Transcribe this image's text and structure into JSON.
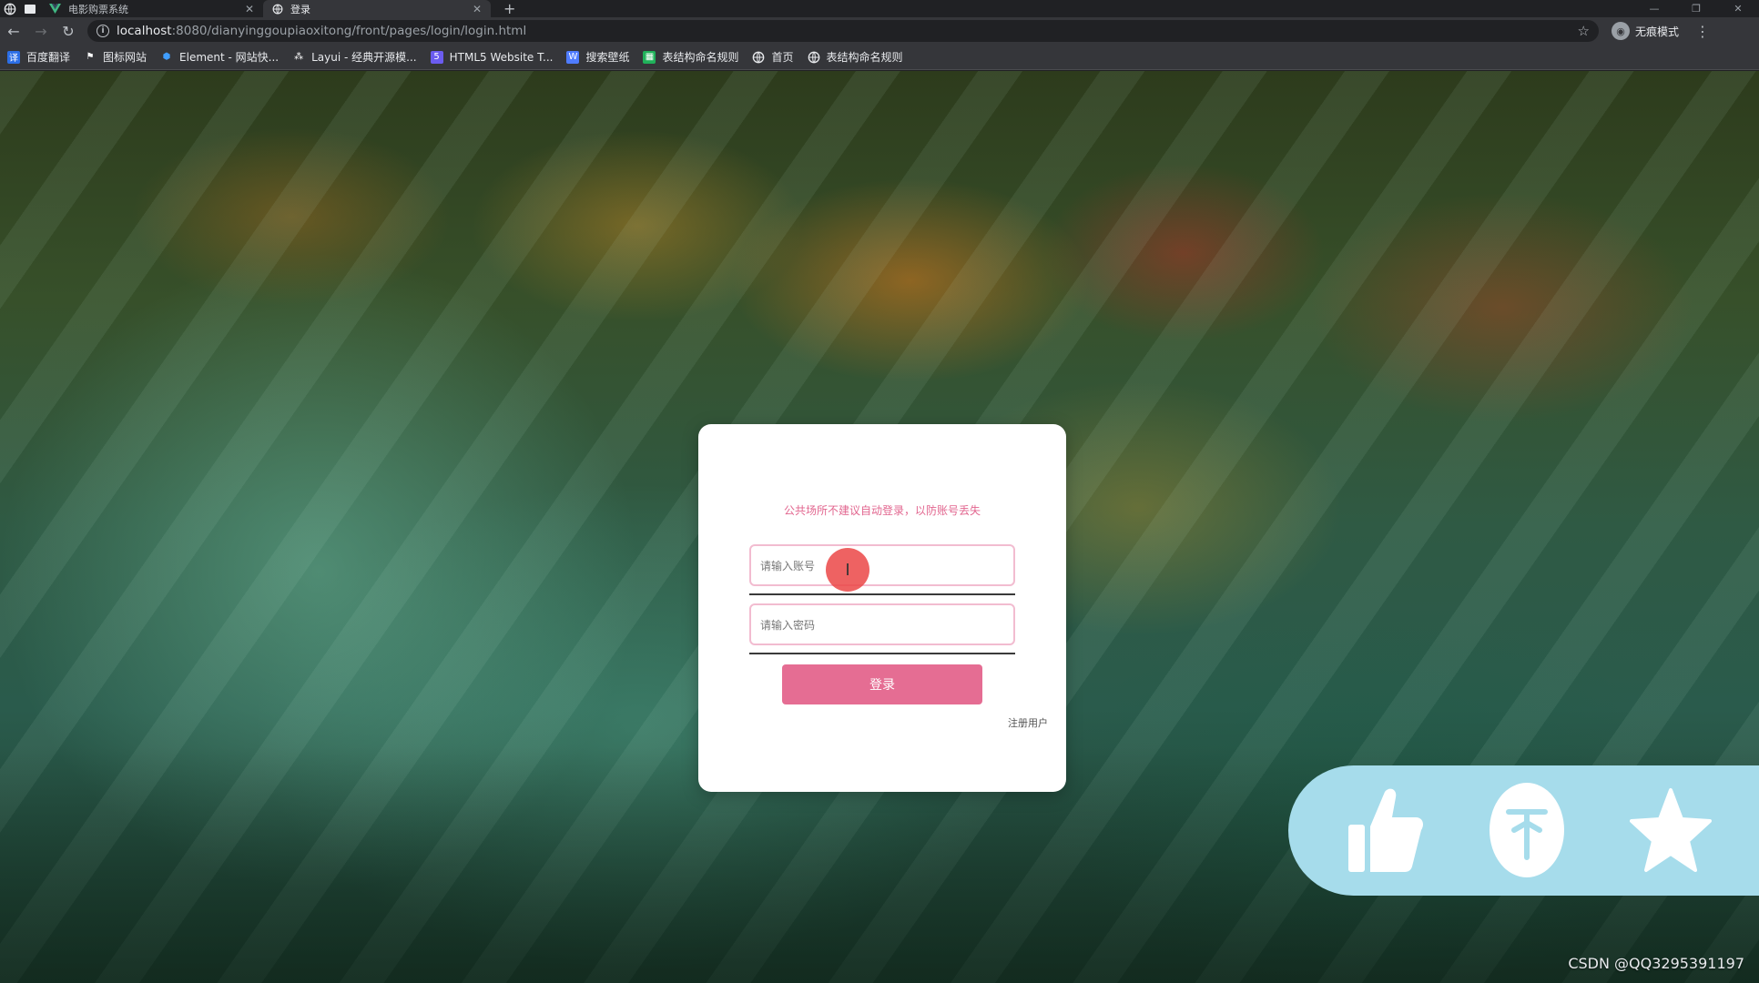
{
  "browser": {
    "tabs": [
      {
        "title": "电影购票系统",
        "active": false
      },
      {
        "title": "登录",
        "active": true
      }
    ],
    "url_host": "localhost",
    "url_rest": ":8080/dianyinggoupiaoxitong/front/pages/login/login.html",
    "profile_label": "无痕模式",
    "bookmarks": [
      {
        "label": "百度翻译",
        "icon": "translate-icon",
        "color": "#2b6ee6"
      },
      {
        "label": "图标网站",
        "icon": "flag-icon",
        "color": "#e8eaed"
      },
      {
        "label": "Element - 网站快...",
        "icon": "element-icon",
        "color": "#409eff"
      },
      {
        "label": "Layui - 经典开源模...",
        "icon": "layui-icon",
        "color": "#e8eaed"
      },
      {
        "label": "HTML5 Website T...",
        "icon": "html5-icon",
        "color": "#6b5cf0"
      },
      {
        "label": "搜索壁纸",
        "icon": "wallpaper-icon",
        "color": "#4f7cff"
      },
      {
        "label": "表结构命名规则",
        "icon": "sheet-icon",
        "color": "#20b15a"
      },
      {
        "label": "首页",
        "icon": "globe-icon",
        "color": "#e8eaed"
      },
      {
        "label": "表结构命名规则",
        "icon": "globe-icon",
        "color": "#e8eaed"
      }
    ]
  },
  "login": {
    "tip": "公共场所不建议自动登录，以防账号丢失",
    "account_placeholder": "请输入账号",
    "password_placeholder": "请输入密码",
    "submit_label": "登录",
    "register_link": "注册用户",
    "accent_color": "#e56d93"
  },
  "overlay": {
    "actions": [
      "thumbs-up-icon",
      "coin-icon",
      "star-icon"
    ],
    "color": "#a6dceb"
  },
  "watermark": "CSDN @QQ3295391197"
}
